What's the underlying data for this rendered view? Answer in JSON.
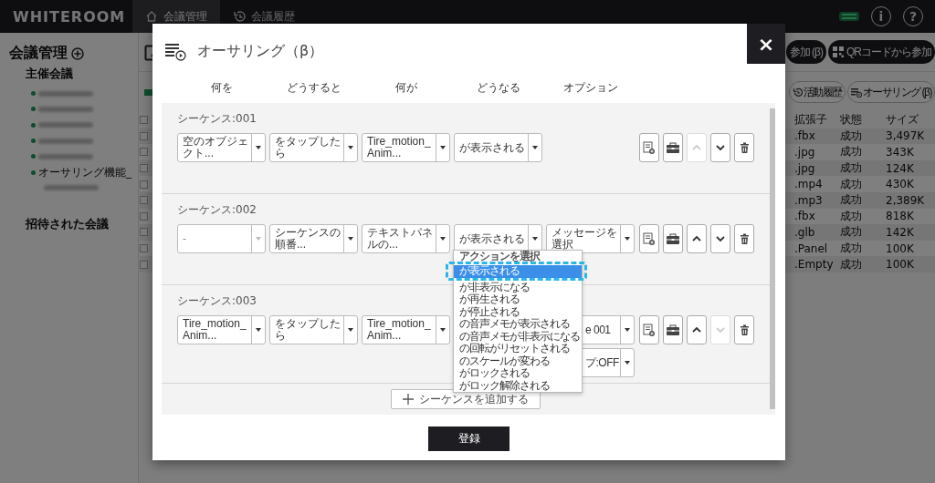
{
  "header": {
    "logo": "WHITEROOM",
    "tabs": [
      {
        "label": "会議管理",
        "selected": true
      },
      {
        "label": "会議履歴",
        "selected": false
      }
    ],
    "info_button": "i",
    "help_button": "?"
  },
  "sidebar": {
    "title": "会議管理",
    "sections": [
      {
        "heading": "主催会議",
        "items": [
          {
            "kind": "redacted"
          },
          {
            "kind": "redacted"
          },
          {
            "kind": "redacted"
          },
          {
            "kind": "redacted"
          },
          {
            "kind": "redacted"
          },
          {
            "kind": "text",
            "label": "オーサリング機能_"
          },
          {
            "kind": "redacted-line"
          }
        ]
      },
      {
        "heading": "招待された会議"
      }
    ]
  },
  "main": {
    "top_buttons": [
      {
        "label": "参加 (β)"
      },
      {
        "label": "QRコードから参加"
      }
    ],
    "tool_buttons": [
      {
        "label": "活動履歴"
      },
      {
        "label": "オーサリング (β)"
      }
    ],
    "table": {
      "header_checked": false,
      "columns": [
        "拡張子",
        "状態",
        "サイズ"
      ],
      "rows": [
        {
          "checked": false,
          "cells": [
            ".fbx",
            "成功",
            "3,497K"
          ]
        },
        {
          "checked": false,
          "cells": [
            ".jpg",
            "成功",
            "343K"
          ]
        },
        {
          "checked": false,
          "cells": [
            ".jpg",
            "成功",
            "124K"
          ]
        },
        {
          "checked": false,
          "cells": [
            ".mp4",
            "成功",
            "430K"
          ]
        },
        {
          "checked": false,
          "cells": [
            ".mp3",
            "成功",
            "2,389K"
          ]
        },
        {
          "checked": false,
          "cells": [
            ".fbx",
            "成功",
            "818K"
          ]
        },
        {
          "checked": false,
          "cells": [
            ".glb",
            "成功",
            "142K"
          ]
        },
        {
          "checked": false,
          "cells": [
            ".Panel",
            "成功",
            "100K"
          ]
        },
        {
          "checked": false,
          "cells": [
            ".Empty",
            "成功",
            "100K"
          ]
        }
      ]
    }
  },
  "modal": {
    "title": "オーサリング（β）",
    "close": "×",
    "columns": [
      "何を",
      "どうすると",
      "何が",
      "どうなる",
      "オプション"
    ],
    "sequences": [
      {
        "title": "シーケンス:001",
        "can_move_up": false,
        "can_move_down": true,
        "fields": [
          {
            "kind": "select",
            "value": "空のオブジェクト...",
            "disabled": false
          },
          {
            "kind": "select",
            "value": "をタップしたら",
            "disabled": false
          },
          {
            "kind": "select",
            "value": "Tire_motion_Anim...",
            "disabled": false
          },
          {
            "kind": "select",
            "value": "が表示される",
            "disabled": false
          }
        ]
      },
      {
        "title": "シーケンス:002",
        "can_move_up": true,
        "can_move_down": true,
        "fields": [
          {
            "kind": "select",
            "value": "-",
            "disabled": true
          },
          {
            "kind": "select",
            "value": "シーケンスの順番...",
            "disabled": false
          },
          {
            "kind": "select",
            "value": "テキストパネルの...",
            "disabled": false
          },
          {
            "kind": "select",
            "value": "が表示される",
            "disabled": false
          },
          {
            "kind": "select",
            "value": "メッセージを選択",
            "disabled": false
          }
        ]
      },
      {
        "title": "シーケンス:003",
        "can_move_up": true,
        "can_move_down": false,
        "fields": [
          {
            "kind": "select",
            "value": "Tire_motion_Anim...",
            "disabled": false
          },
          {
            "kind": "select",
            "value": "をタップしたら",
            "disabled": false
          },
          {
            "kind": "select",
            "value": "Tire_motion_Anim...",
            "disabled": false
          },
          {
            "kind": "covered"
          },
          {
            "kind": "partial",
            "value": "e 001",
            "disabled": false
          }
        ],
        "extra_fields": [
          {
            "kind": "partial",
            "value": "プ:OFF",
            "disabled": false
          }
        ]
      }
    ],
    "add_button": "シーケンスを追加する",
    "submit": "登録",
    "dropdown": {
      "header": "アクションを選択",
      "options": [
        {
          "label": "が表示される",
          "selected": true
        },
        {
          "label": "が非表示になる",
          "selected": false
        },
        {
          "label": "が再生される",
          "selected": false
        },
        {
          "label": "が停止される",
          "selected": false
        },
        {
          "label": "の音声メモが表示される",
          "selected": false
        },
        {
          "label": "の音声メモが非表示になる",
          "selected": false
        },
        {
          "label": "の回転がリセットされる",
          "selected": false
        },
        {
          "label": "のスケールが変わる",
          "selected": false
        },
        {
          "label": "がロックされる",
          "selected": false
        },
        {
          "label": "がロック解除される",
          "selected": false
        }
      ]
    }
  }
}
